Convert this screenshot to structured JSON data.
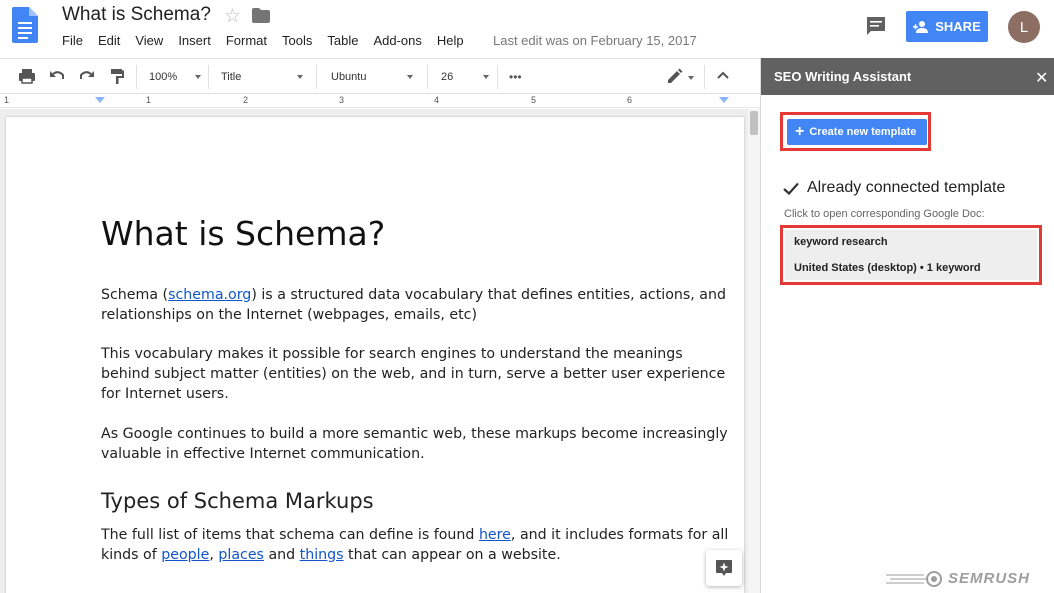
{
  "header": {
    "title": "What is Schema?",
    "menu": [
      "File",
      "Edit",
      "View",
      "Insert",
      "Format",
      "Tools",
      "Table",
      "Add-ons",
      "Help"
    ],
    "last_edit": "Last edit was on February 15, 2017",
    "share_label": "SHARE",
    "avatar_initial": "L"
  },
  "toolbar": {
    "zoom": "100%",
    "style": "Title",
    "font": "Ubuntu",
    "size": "26",
    "more": "•••"
  },
  "ruler": {
    "numbers": [
      "1",
      "1",
      "2",
      "3",
      "4",
      "5",
      "6"
    ]
  },
  "document": {
    "h1": "What is Schema?",
    "p1_before": "Schema (",
    "p1_link": "schema.org",
    "p1_after": ") is a structured data vocabulary that defines entities, actions, and relationships on the Internet (webpages, emails, etc)",
    "p2": "This vocabulary makes it possible for search engines to understand the meanings behind subject matter (entities) on the web, and in turn, serve a better user experience for Internet users.",
    "p3": "As Google continues to build a more semantic web, these markups become increasingly valuable in effective Internet communication.",
    "h2": "Types of Schema Markups",
    "p4_a": "The full list of items that schema can define is found ",
    "p4_link1": "here",
    "p4_b": ", and it includes formats for all kinds of ",
    "p4_link2": "people",
    "p4_c": ", ",
    "p4_link3": "places",
    "p4_d": " and ",
    "p4_link4": "things",
    "p4_e": " that can appear on a website."
  },
  "sidebar": {
    "title": "SEO Writing Assistant",
    "close": "✕",
    "create_label": "Create new template",
    "connected_label": "Already connected template",
    "click_hint": "Click to open corresponding Google Doc:",
    "template_name": "keyword research",
    "template_meta": "United States (desktop) • 1 keyword",
    "brand": "SEMRUSH",
    "highlight_color": "#e53935",
    "accent_color": "#4285f4"
  }
}
